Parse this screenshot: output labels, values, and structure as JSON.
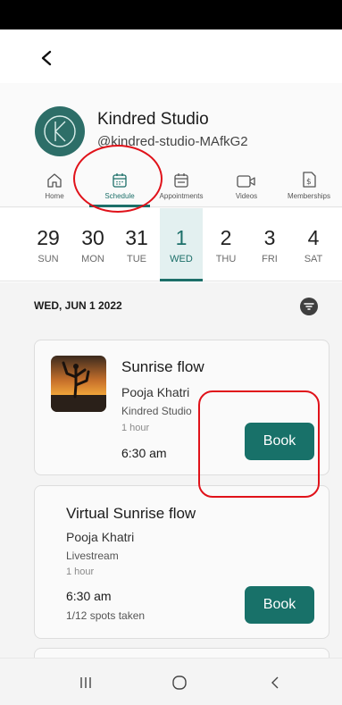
{
  "header": {
    "studio_name": "Kindred Studio",
    "studio_handle": "@kindred-studio-MAfkG2"
  },
  "tabs": [
    {
      "label": "Home",
      "icon": "home-icon",
      "active": false
    },
    {
      "label": "Schedule",
      "icon": "calendar-icon",
      "active": true
    },
    {
      "label": "Appointments",
      "icon": "calendar-check-icon",
      "active": false
    },
    {
      "label": "Videos",
      "icon": "video-icon",
      "active": false
    },
    {
      "label": "Memberships",
      "icon": "membership-icon",
      "active": false
    }
  ],
  "dates": [
    {
      "num": "29",
      "day": "SUN",
      "active": false
    },
    {
      "num": "30",
      "day": "MON",
      "active": false
    },
    {
      "num": "31",
      "day": "TUE",
      "active": false
    },
    {
      "num": "1",
      "day": "WED",
      "active": true
    },
    {
      "num": "2",
      "day": "THU",
      "active": false
    },
    {
      "num": "3",
      "day": "FRI",
      "active": false
    },
    {
      "num": "4",
      "day": "SAT",
      "active": false
    }
  ],
  "schedule": {
    "date_heading": "WED, JUN 1 2022",
    "classes": [
      {
        "title": "Sunrise flow",
        "teacher": "Pooja Khatri",
        "location": "Kindred Studio",
        "duration": "1 hour",
        "time": "6:30 am",
        "book_label": "Book"
      },
      {
        "title": "Virtual Sunrise flow",
        "teacher": "Pooja Khatri",
        "location": "Livestream",
        "duration": "1 hour",
        "time": "6:30 am",
        "spots": "1/12 spots taken",
        "book_label": "Book"
      }
    ]
  },
  "colors": {
    "accent": "#1c6f69",
    "button": "#187169",
    "annotation": "#e0121a"
  }
}
